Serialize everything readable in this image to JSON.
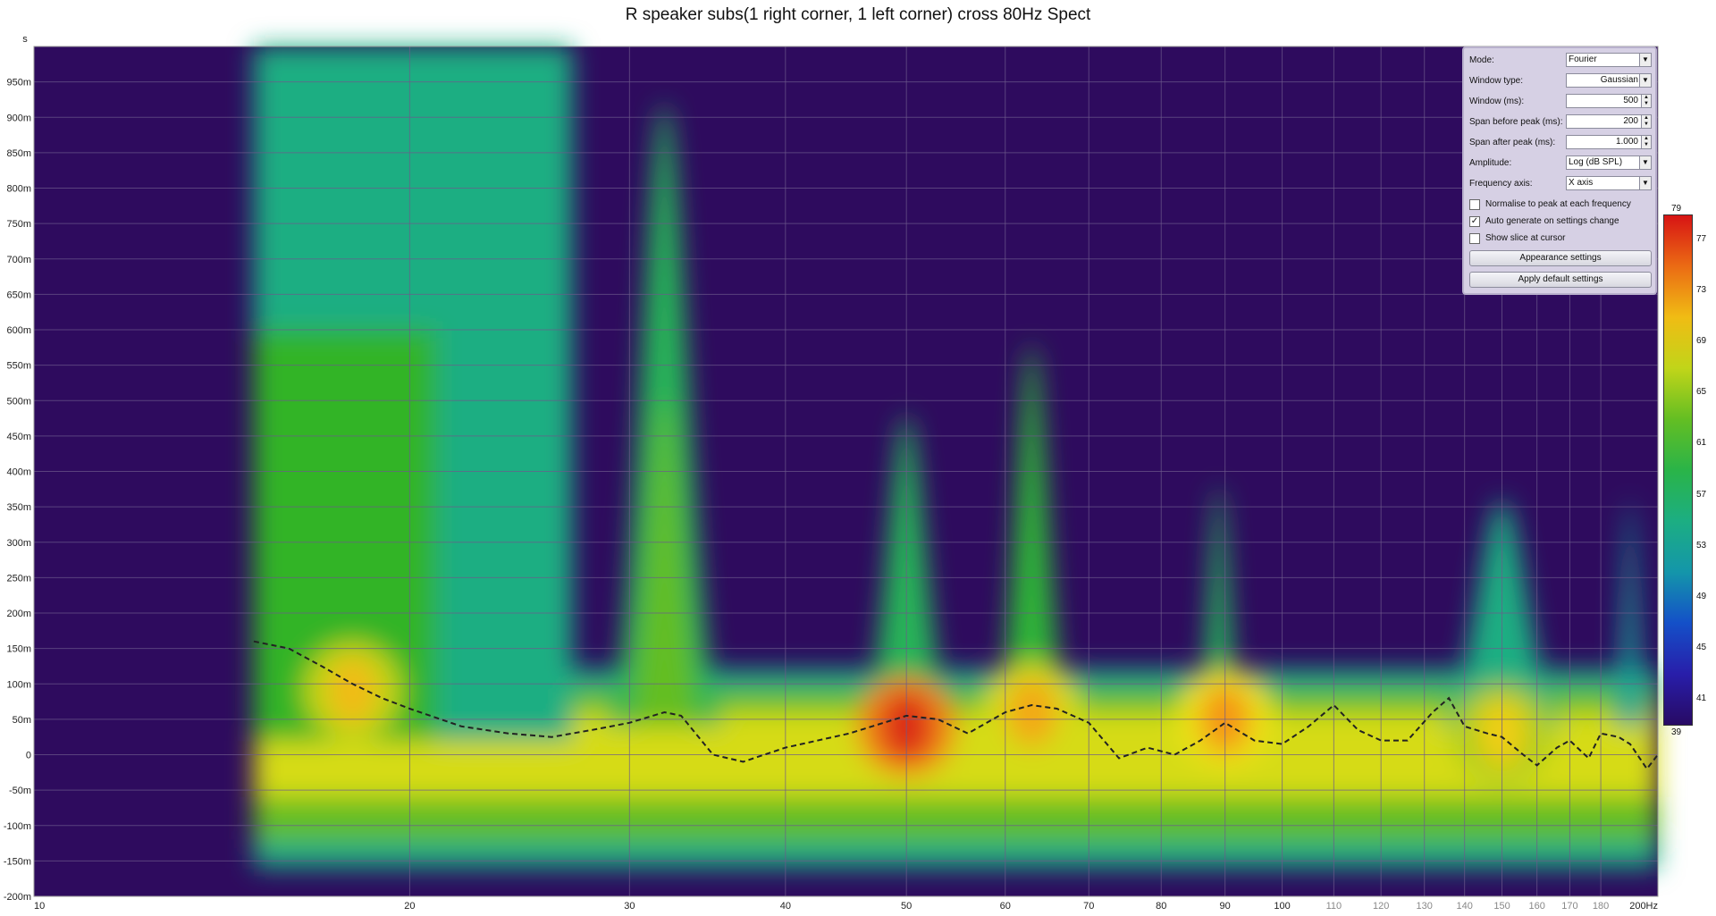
{
  "chart_data": {
    "type": "heatmap",
    "title": "R speaker subs(1 right corner, 1 left corner) cross 80Hz Spect",
    "xscale": "log",
    "xlim": [
      10,
      200
    ],
    "ylim": [
      -0.2,
      1.0
    ],
    "ylabel": "s",
    "x_ticks": [
      {
        "v": 10,
        "label": "10",
        "minor": false
      },
      {
        "v": 20,
        "label": "20",
        "minor": false
      },
      {
        "v": 30,
        "label": "30",
        "minor": false
      },
      {
        "v": 40,
        "label": "40",
        "minor": false
      },
      {
        "v": 50,
        "label": "50",
        "minor": false
      },
      {
        "v": 60,
        "label": "60",
        "minor": false
      },
      {
        "v": 70,
        "label": "70",
        "minor": false
      },
      {
        "v": 80,
        "label": "80",
        "minor": false
      },
      {
        "v": 90,
        "label": "90",
        "minor": false
      },
      {
        "v": 100,
        "label": "100",
        "minor": false
      },
      {
        "v": 110,
        "label": "110",
        "minor": true
      },
      {
        "v": 120,
        "label": "120",
        "minor": true
      },
      {
        "v": 130,
        "label": "130",
        "minor": true
      },
      {
        "v": 140,
        "label": "140",
        "minor": true
      },
      {
        "v": 150,
        "label": "150",
        "minor": true
      },
      {
        "v": 160,
        "label": "160",
        "minor": true
      },
      {
        "v": 170,
        "label": "170",
        "minor": true
      },
      {
        "v": 180,
        "label": "180",
        "minor": true
      },
      {
        "v": 200,
        "label": "200Hz",
        "minor": false
      }
    ],
    "y_ticks": [
      {
        "v": 0.95,
        "label": "950m"
      },
      {
        "v": 0.9,
        "label": "900m"
      },
      {
        "v": 0.85,
        "label": "850m"
      },
      {
        "v": 0.8,
        "label": "800m"
      },
      {
        "v": 0.75,
        "label": "750m"
      },
      {
        "v": 0.7,
        "label": "700m"
      },
      {
        "v": 0.65,
        "label": "650m"
      },
      {
        "v": 0.6,
        "label": "600m"
      },
      {
        "v": 0.55,
        "label": "550m"
      },
      {
        "v": 0.5,
        "label": "500m"
      },
      {
        "v": 0.45,
        "label": "450m"
      },
      {
        "v": 0.4,
        "label": "400m"
      },
      {
        "v": 0.35,
        "label": "350m"
      },
      {
        "v": 0.3,
        "label": "300m"
      },
      {
        "v": 0.25,
        "label": "250m"
      },
      {
        "v": 0.2,
        "label": "200m"
      },
      {
        "v": 0.15,
        "label": "150m"
      },
      {
        "v": 0.1,
        "label": "100m"
      },
      {
        "v": 0.05,
        "label": "50m"
      },
      {
        "v": 0.0,
        "label": "0"
      },
      {
        "v": -0.05,
        "label": "-50m"
      },
      {
        "v": -0.1,
        "label": "-100m"
      },
      {
        "v": -0.15,
        "label": "-150m"
      },
      {
        "v": -0.2,
        "label": "-200m"
      }
    ],
    "data_start_hz": 15,
    "features": [
      {
        "kind": "column",
        "fLow": 15,
        "fHigh": 27,
        "tTop": 1.0,
        "level": 55
      },
      {
        "kind": "column",
        "fLow": 15,
        "fHigh": 21,
        "tTop": 0.6,
        "level": 61
      },
      {
        "kind": "hump",
        "f": 32,
        "width": 0.075,
        "tTop": 0.92,
        "level": 58
      },
      {
        "kind": "hump",
        "f": 32,
        "width": 0.05,
        "tTop": 0.5,
        "level": 63
      },
      {
        "kind": "hump",
        "f": 50,
        "width": 0.06,
        "tTop": 0.48,
        "level": 58
      },
      {
        "kind": "hump",
        "f": 63,
        "width": 0.05,
        "tTop": 0.58,
        "level": 60
      },
      {
        "kind": "hump",
        "f": 89,
        "width": 0.03,
        "tTop": 0.38,
        "level": 58
      },
      {
        "kind": "hump",
        "f": 150,
        "width": 0.08,
        "tTop": 0.36,
        "level": 55
      },
      {
        "kind": "hump",
        "f": 190,
        "width": 0.02,
        "tTop": 0.36,
        "level": 53
      }
    ],
    "peaks": [
      {
        "f": 18,
        "t": 0.09,
        "level": 71
      },
      {
        "f": 50,
        "t": 0.04,
        "level": 78
      },
      {
        "f": 63,
        "t": 0.06,
        "level": 72
      },
      {
        "f": 90,
        "t": 0.05,
        "level": 73
      },
      {
        "f": 150,
        "t": 0.03,
        "level": 70
      }
    ],
    "dashed_curve": {
      "name": "",
      "x": [
        15,
        16,
        17,
        18,
        19,
        20,
        22,
        24,
        26,
        28,
        30,
        32,
        33,
        35,
        37,
        40,
        45,
        50,
        53,
        56,
        60,
        63,
        66,
        70,
        74,
        78,
        82,
        86,
        90,
        95,
        100,
        105,
        110,
        115,
        120,
        126,
        132,
        136,
        140,
        146,
        150,
        156,
        160,
        166,
        170,
        176,
        180,
        186,
        190,
        196,
        200
      ],
      "y": [
        0.16,
        0.15,
        0.125,
        0.1,
        0.08,
        0.065,
        0.04,
        0.03,
        0.025,
        0.035,
        0.045,
        0.06,
        0.055,
        0.0,
        -0.01,
        0.01,
        0.03,
        0.055,
        0.05,
        0.03,
        0.06,
        0.07,
        0.065,
        0.045,
        -0.005,
        0.01,
        0.0,
        0.02,
        0.045,
        0.02,
        0.015,
        0.04,
        0.07,
        0.035,
        0.02,
        0.02,
        0.06,
        0.08,
        0.04,
        0.03,
        0.025,
        0.0,
        -0.015,
        0.01,
        0.02,
        -0.005,
        0.03,
        0.025,
        0.015,
        -0.02,
        0.0
      ]
    },
    "colorbar": {
      "min": 39,
      "max": 79,
      "ticks": [
        "77",
        "73",
        "69",
        "65",
        "61",
        "57",
        "53",
        "49",
        "45",
        "41"
      ],
      "label_max": "79",
      "label_min": "39"
    },
    "colors": {
      "background": "#2e0b5e",
      "grid": "#6e5a8c",
      "curve": "#222222"
    },
    "grid": true
  },
  "panel": {
    "mode": {
      "label": "Mode:",
      "value": "Fourier"
    },
    "window_type": {
      "label": "Window type:",
      "value": "Gaussian"
    },
    "window_ms": {
      "label": "Window (ms):",
      "value": "500"
    },
    "span_before": {
      "label": "Span before peak (ms):",
      "value": "200"
    },
    "span_after": {
      "label": "Span after peak (ms):",
      "value": "1.000"
    },
    "amplitude": {
      "label": "Amplitude:",
      "value": "Log (dB SPL)"
    },
    "frequency_axis": {
      "label": "Frequency axis:",
      "value": "X axis"
    },
    "normalise": {
      "label": "Normalise to peak at each frequency",
      "checked": false
    },
    "auto_generate": {
      "label": "Auto generate on settings change",
      "checked": true
    },
    "show_slice": {
      "label": "Show slice at cursor",
      "checked": false
    },
    "appearance_button": "Appearance settings",
    "defaults_button": "Apply default settings"
  }
}
